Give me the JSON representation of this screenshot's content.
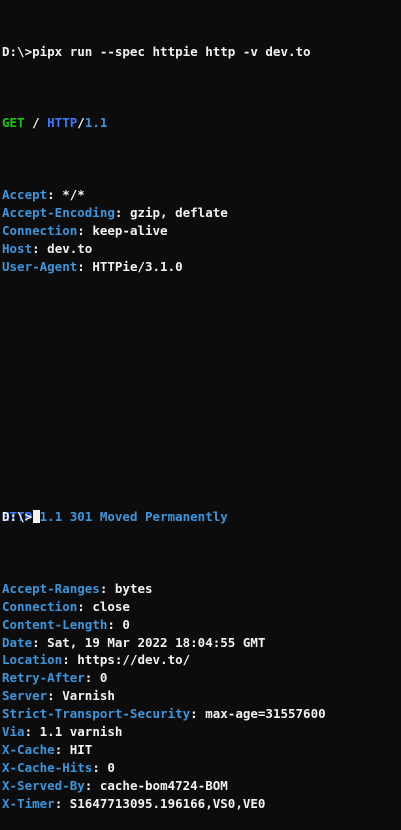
{
  "command_line": "D:\\>pipx run --spec httpie http -v dev.to",
  "request": {
    "method": "GET",
    "sep": " / ",
    "protocol": "HTTP",
    "slash": "/",
    "version": "1.1",
    "headers": [
      {
        "key": "Accept",
        "value": "*/*"
      },
      {
        "key": "Accept-Encoding",
        "value": "gzip, deflate"
      },
      {
        "key": "Connection",
        "value": "keep-alive"
      },
      {
        "key": "Host",
        "value": "dev.to"
      },
      {
        "key": "User-Agent",
        "value": "HTTPie/3.1.0"
      }
    ]
  },
  "response": {
    "protocol": "HTTP",
    "slash": "/",
    "version": "1.1",
    "status": " 301 Moved Permanently",
    "headers": [
      {
        "key": "Accept-Ranges",
        "value": "bytes"
      },
      {
        "key": "Connection",
        "value": "close"
      },
      {
        "key": "Content-Length",
        "value": "0"
      },
      {
        "key": "Date",
        "value": "Sat, 19 Mar 2022 18:04:55 GMT"
      },
      {
        "key": "Location",
        "value": "https://dev.to/"
      },
      {
        "key": "Retry-After",
        "value": "0"
      },
      {
        "key": "Server",
        "value": "Varnish"
      },
      {
        "key": "Strict-Transport-Security",
        "value": "max-age=31557600"
      },
      {
        "key": "Via",
        "value": "1.1 varnish"
      },
      {
        "key": "X-Cache",
        "value": "HIT"
      },
      {
        "key": "X-Cache-Hits",
        "value": "0"
      },
      {
        "key": "X-Served-By",
        "value": "cache-bom4724-BOM"
      },
      {
        "key": "X-Timer",
        "value": "S1647713095.196166,VS0,VE0"
      }
    ]
  },
  "prompt": "D:\\>",
  "header_sep": ": ",
  "colors": {
    "background": "#0c0c0c",
    "foreground": "#f2f2f2",
    "key": "#3a96dd",
    "method": "#16c60c",
    "protocol": "#3b78ff"
  }
}
